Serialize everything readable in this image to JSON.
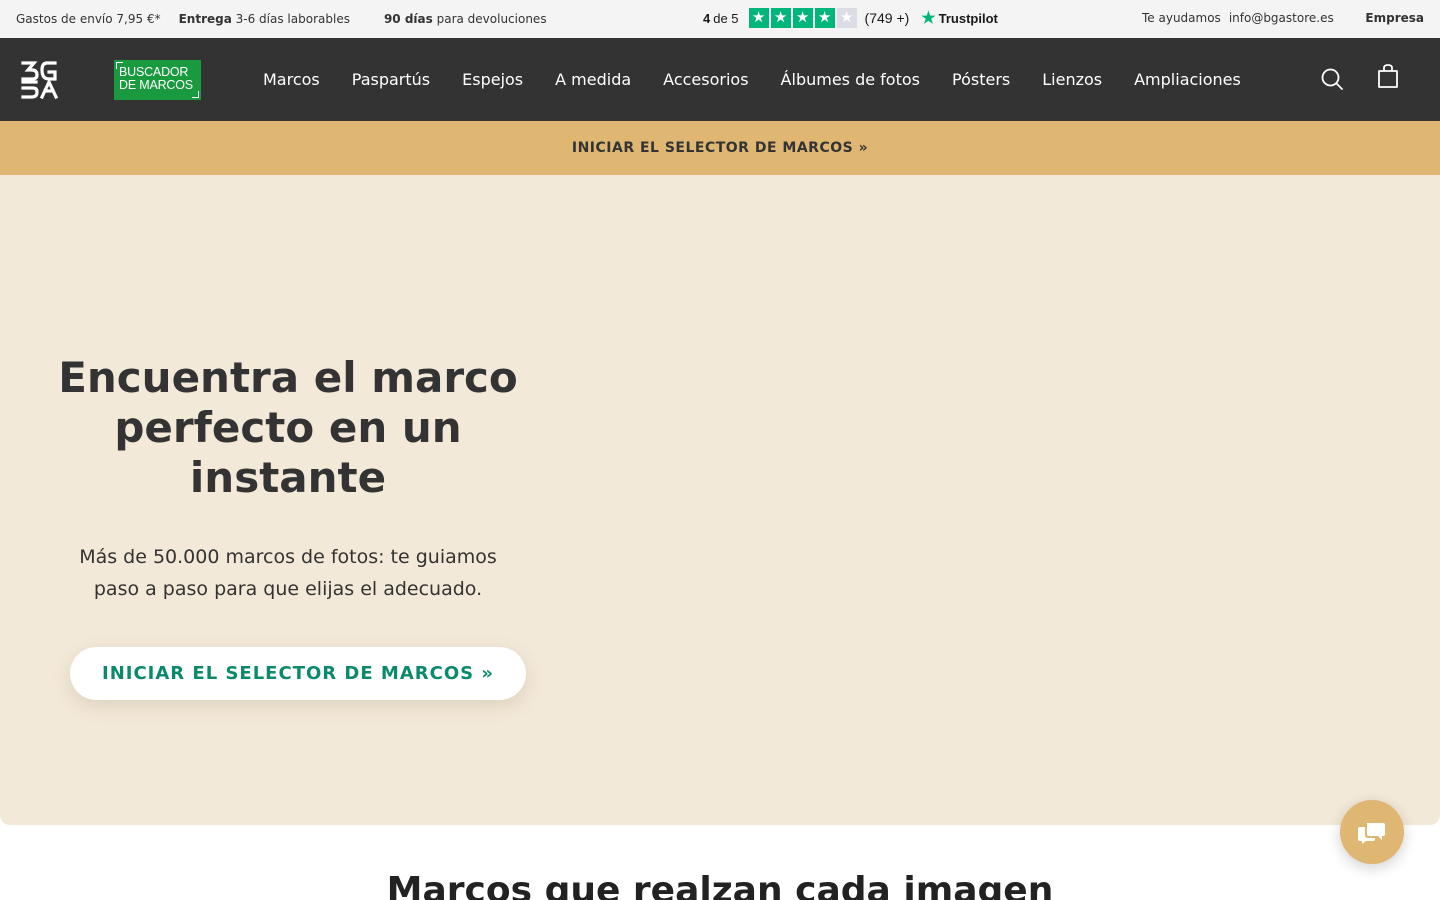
{
  "topbar": {
    "shipping": "Gastos de envío 7,95 €*",
    "delivery_bold": "Entrega",
    "delivery_rest": " 3-6 días laborables",
    "returns_bold": "90 días",
    "returns_rest": " para devoluciones",
    "help_label": "Te ayudamos",
    "help_email": "info@bgastore.es",
    "business": "Empresa"
  },
  "trustpilot": {
    "score": "4",
    "of_label": "de 5",
    "count": "(749 +)",
    "brand": "Trustpilot",
    "rating": 4,
    "max_rating": 5,
    "star_color": "#00b67a"
  },
  "nav": {
    "finder_logo": "BUSCADOR DE MARCOS",
    "finder_color": "#1a9a3f",
    "items": [
      "Marcos",
      "Paspartús",
      "Espejos",
      "A medida",
      "Accesorios",
      "Álbumes de fotos",
      "Pósters",
      "Lienzos",
      "Ampliaciones"
    ],
    "search_icon": "search-icon",
    "cart_icon": "shopping-bag-icon"
  },
  "promo": {
    "label": "INICIAR EL SELECTOR DE MARCOS »",
    "color": "#dfb773"
  },
  "hero": {
    "title": "Encuentra el marco perfecto en un instante",
    "subtitle": "Más de 50.000 marcos de fotos: te guiamos paso a paso para que elijas el adecuado.",
    "cta": "INICIAR EL SELECTOR DE MARCOS »",
    "background": "#f3e9d8",
    "cta_color": "#0a8a6a"
  },
  "section": {
    "title": "Marcos que realzan cada imagen"
  },
  "chat": {
    "icon": "chat-bubble-icon"
  }
}
